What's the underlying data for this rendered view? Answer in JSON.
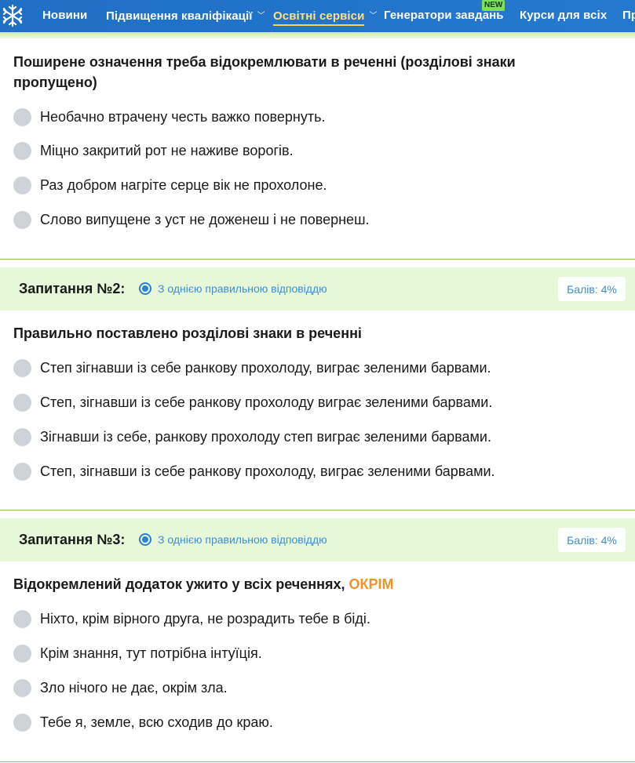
{
  "nav": {
    "items": [
      {
        "label": "Новини"
      },
      {
        "label": "Підвищення кваліфікації"
      },
      {
        "label": "Освітні сервіси"
      },
      {
        "label": "Генератори завдань"
      },
      {
        "label": "Курси для всіх"
      },
      {
        "label": "Пр"
      }
    ],
    "new_badge": "NEW"
  },
  "q1": {
    "title_line1": "Поширене означення треба відокремлювати в реченні (розділові знаки",
    "title_line2": "пропущено)",
    "options": [
      "Необачно втрачену честь важко повернуть.",
      "Міцно закритий рот не наживе ворогів.",
      "Раз добром нагріте серце вік не прохолоне.",
      "Слово випущене з уст не доженеш і не повернеш."
    ]
  },
  "q2": {
    "number": "Запитання №2:",
    "type": "З однією правильною відповіддю",
    "points": "Балів: 4%",
    "title": "Правильно поставлено розділові знаки в реченні",
    "options": [
      "Степ зігнавши із себе ранкову прохолоду, виграє зеленими барвами.",
      "Степ, зігнавши із себе ранкову прохолоду виграє зеленими барвами.",
      "Зігнавши із себе, ранкову прохолоду степ виграє зеленими барвами.",
      "Степ, зігнавши із себе ранкову прохолоду, виграє зеленими барвами."
    ]
  },
  "q3": {
    "number": "Запитання №3:",
    "type": "З однією правильною відповіддю",
    "points": "Балів: 4%",
    "title": "Відокремлений додаток ужито у всіх реченнях,",
    "title_accent": "ОКРІМ",
    "options": [
      "Ніхто, крім вірного друга, не розрадить тебе в біді.",
      "Крім знання, тут потрібна інтуїція.",
      "Зло нічого не дає, окрім зла.",
      "Тебе я, земле, всю сходив до краю."
    ]
  },
  "colors": {
    "nav_bg": "#2479cf",
    "header_bg": "#e6f8d8",
    "accent": "#f0932b",
    "link": "#3b8fd8"
  },
  "icons": {
    "logo": "snowflake-logo-icon",
    "chevron": "chevron-down-icon",
    "radio": "radio-button-icon"
  }
}
